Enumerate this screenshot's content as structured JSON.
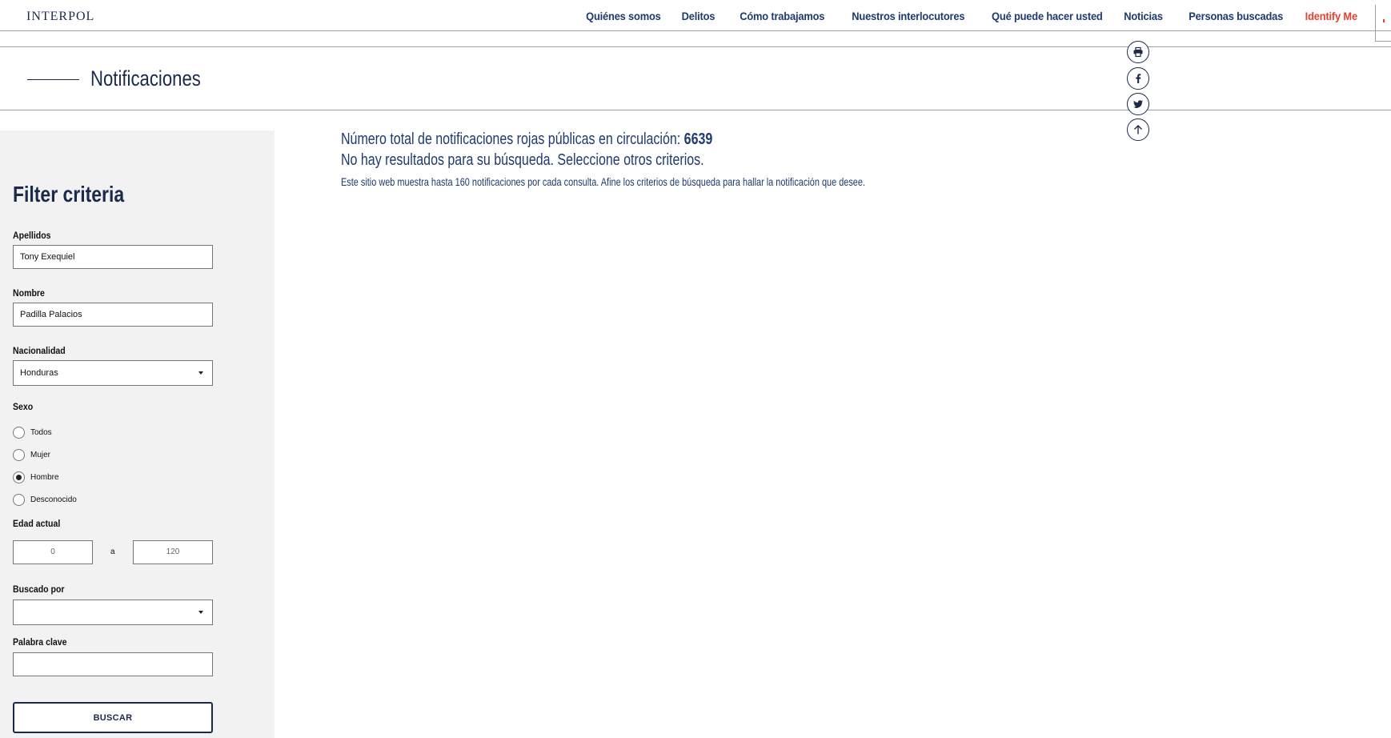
{
  "header": {
    "logo": "INTERPOL",
    "nav": [
      "Quiénes somos",
      "Delitos",
      "Cómo trabajamos",
      "Nuestros interlocutores",
      "Qué puede hacer usted",
      "Noticias",
      "Personas buscadas",
      "Identify Me"
    ],
    "accent_color": "#e8402d"
  },
  "page": {
    "title": "Notificaciones"
  },
  "share": {
    "icons": [
      "print-icon",
      "facebook-icon",
      "twitter-icon",
      "arrow-up-icon"
    ]
  },
  "filters": {
    "title": "Filter criteria",
    "apellidos": {
      "label": "Apellidos",
      "value": "Tony Exequiel"
    },
    "nombre": {
      "label": "Nombre",
      "value": "Padilla Palacios"
    },
    "nacionalidad": {
      "label": "Nacionalidad",
      "value": "Honduras"
    },
    "sexo": {
      "label": "Sexo",
      "options": [
        "Todos",
        "Mujer",
        "Hombre",
        "Desconocido"
      ],
      "selected": "Hombre"
    },
    "edad": {
      "label": "Edad actual",
      "min": "0",
      "separator": "a",
      "max": "120"
    },
    "buscado_por": {
      "label": "Buscado por",
      "value": ""
    },
    "palabra_clave": {
      "label": "Palabra clave",
      "value": ""
    },
    "submit": "BUSCAR"
  },
  "results": {
    "total_text": "Número total de notificaciones rojas públicas en circulación: ",
    "total_count": "6639",
    "no_results": "No hay resultados para su búsqueda. Seleccione otros criterios.",
    "note": "Este sitio web muestra hasta 160 notificaciones por cada consulta. Afine los criterios de búsqueda para hallar la notificación que desee."
  }
}
